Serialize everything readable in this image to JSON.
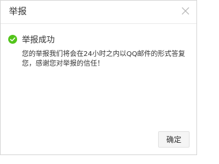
{
  "dialog": {
    "title": "举报",
    "close_icon": "close-icon",
    "status": {
      "icon": "check-circle-icon",
      "color": "#52c41a",
      "text": "举报成功"
    },
    "message_lines": [
      "您的举报我们将会在24小时之内以QQ邮件的形式答复",
      "您，感谢您对举报的信任！"
    ],
    "confirm_label": "确定"
  }
}
